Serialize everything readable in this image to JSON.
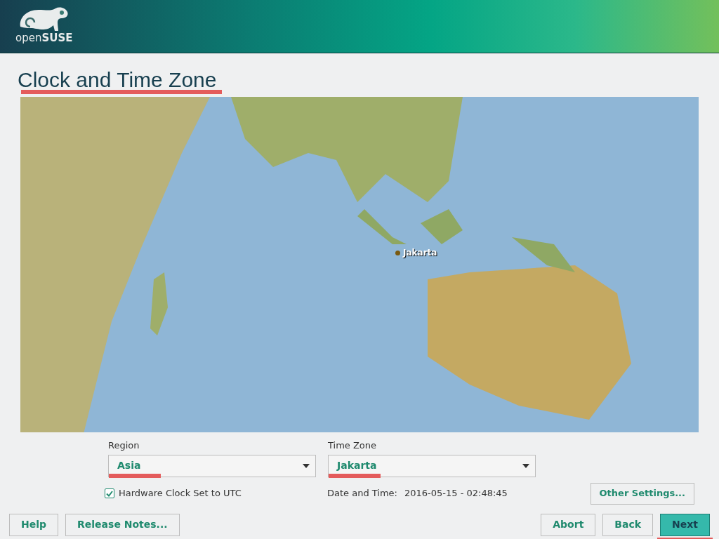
{
  "header": {
    "logo_text_light": "open",
    "logo_text_bold": "SUSE"
  },
  "title": {
    "text": "Clock and Time Zone",
    "highlighted": true
  },
  "map": {
    "marker": {
      "label": "Jakarta"
    }
  },
  "region": {
    "label": "Region",
    "value": "Asia",
    "highlighted": true
  },
  "time_zone": {
    "label": "Time Zone",
    "value": "Jakarta",
    "highlighted": true
  },
  "hardware_clock": {
    "label": "Hardware Clock Set to UTC",
    "checked": true
  },
  "date_time": {
    "label": "Date and Time:",
    "value": "2016-05-15 - 02:48:45"
  },
  "other_settings": {
    "label": "Other Settings..."
  },
  "buttons_left": [
    {
      "label": "Help",
      "primary": false,
      "highlighted": false
    },
    {
      "label": "Release Notes...",
      "primary": false,
      "highlighted": false
    }
  ],
  "buttons_right": [
    {
      "label": "Abort",
      "primary": false,
      "highlighted": false
    },
    {
      "label": "Back",
      "primary": false,
      "highlighted": false
    },
    {
      "label": "Next",
      "primary": true,
      "highlighted": true
    }
  ]
}
